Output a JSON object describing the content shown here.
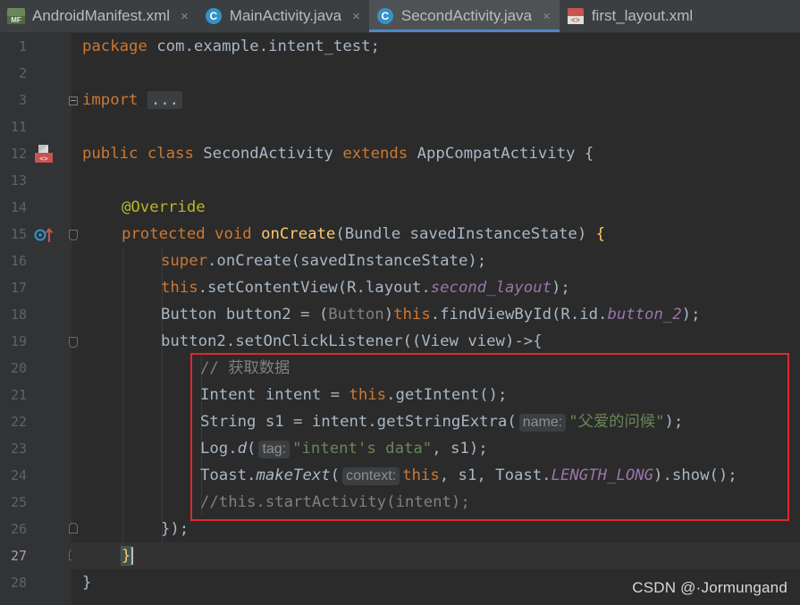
{
  "tabs": [
    {
      "label": "AndroidManifest.xml",
      "icon": "manifest-file-icon",
      "active": false
    },
    {
      "label": "MainActivity.java",
      "icon": "java-class-icon",
      "active": false
    },
    {
      "label": "SecondActivity.java",
      "icon": "java-class-icon",
      "active": true
    },
    {
      "label": "first_layout.xml",
      "icon": "layout-xml-icon",
      "active": false
    }
  ],
  "tab_icon_text": {
    "manifest": "MF",
    "class": "C",
    "xml": "<>"
  },
  "tab_close_glyph": "×",
  "gutter": {
    "line_numbers": [
      "1",
      "2",
      "3",
      "11",
      "12",
      "13",
      "14",
      "15",
      "16",
      "17",
      "18",
      "19",
      "20",
      "21",
      "22",
      "23",
      "24",
      "25",
      "26",
      "27",
      "28"
    ],
    "current_line": "27"
  },
  "code": {
    "l1": {
      "kw": "package",
      "rest": " com.example.intent_test;"
    },
    "l3": {
      "kw": "import",
      "folded": "..."
    },
    "l12": {
      "kw1": "public",
      "kw2": "class",
      "name": "SecondActivity",
      "kw3": "extends",
      "parent": "AppCompatActivity",
      "brace": "{"
    },
    "l14": {
      "annotation": "@Override"
    },
    "l15": {
      "kw1": "protected",
      "kw2": "void",
      "method": "onCreate",
      "params": "(Bundle savedInstanceState) ",
      "brace": "{"
    },
    "l16": {
      "kw": "super",
      "rest": ".onCreate(savedInstanceState);"
    },
    "l17": {
      "kw": "this",
      "a": ".setContentView(R.layout.",
      "field": "second_layout",
      "b": ");"
    },
    "l18": {
      "a": "Button button2 = ",
      "cast_open": "(",
      "cast_type": "Button",
      "cast_close": ")",
      "kw": "this",
      "b": ".findViewById(R.id.",
      "field": "button_2",
      "c": ");"
    },
    "l19": {
      "text": "button2.setOnClickListener((View view)->{"
    },
    "l20": {
      "comment": "// 获取数据"
    },
    "l21": {
      "a": "Intent intent = ",
      "kw": "this",
      "b": ".getIntent();"
    },
    "l22": {
      "a": "String s1 = intent.getStringExtra(",
      "hint": "name:",
      "str": "\"父爱的问候\"",
      "b": ");"
    },
    "l23": {
      "a": "Log.",
      "method": "d",
      "b": "(",
      "hint": "tag:",
      "str": "\"intent's data\"",
      "c": ", s1);"
    },
    "l24": {
      "a": "Toast.",
      "method": "makeText",
      "b": "(",
      "hint": "context:",
      "kw": "this",
      "c": ", s1, Toast.",
      "field": "LENGTH_LONG",
      "d": ").show();"
    },
    "l25": {
      "comment": "//this.startActivity(intent);"
    },
    "l26": {
      "text": "});"
    },
    "l27": {
      "brace": "}"
    },
    "l28": {
      "brace": "}"
    }
  },
  "watermark": "CSDN @·Jormungand",
  "colors": {
    "background": "#2b2b2b",
    "keyword": "#cc7832",
    "method": "#ffc66d",
    "string": "#6a8759",
    "comment": "#808080",
    "field": "#9876aa",
    "annotation": "#bbb529",
    "highlight_box": "#e0282e",
    "active_tab_underline": "#4a88c7"
  }
}
